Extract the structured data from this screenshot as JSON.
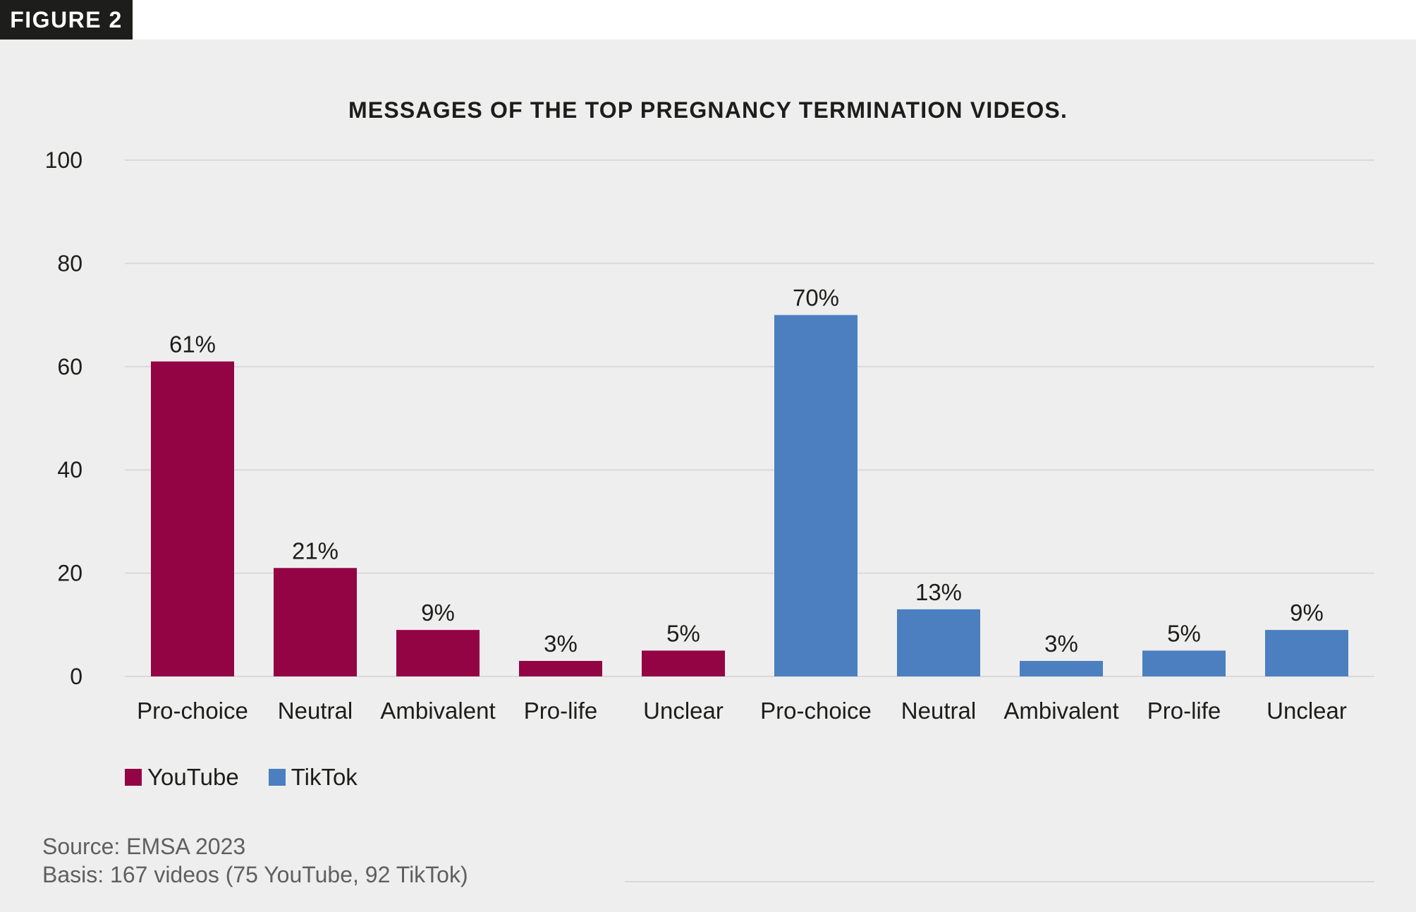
{
  "figure_label": "FIGURE 2",
  "source": {
    "line1": "Source: EMSA 2023",
    "line2": "Basis: 167 videos (75 YouTube, 92 TikTok)"
  },
  "colors": {
    "youtube": "#930444",
    "tiktok": "#4b7fc0",
    "background": "#eeeeee",
    "grid": "#d9d9d9",
    "text": "#1d1d1b"
  },
  "chart_data": {
    "type": "bar",
    "title": "MESSAGES OF THE TOP PREGNANCY TERMINATION VIDEOS.",
    "xlabel": "",
    "ylabel": "",
    "ylim": [
      0,
      100
    ],
    "yticks": [
      0,
      20,
      40,
      60,
      80,
      100
    ],
    "grid": true,
    "legend_position": "bottom-left",
    "value_suffix": "%",
    "groups": [
      {
        "name": "YouTube",
        "color": "#930444",
        "categories": [
          "Pro-choice",
          "Neutral",
          "Ambivalent",
          "Pro-life",
          "Unclear"
        ],
        "values": [
          61,
          21,
          9,
          3,
          5
        ],
        "labels": [
          "61%",
          "21%",
          "9%",
          "3%",
          "5%"
        ]
      },
      {
        "name": "TikTok",
        "color": "#4b7fc0",
        "categories": [
          "Pro-choice",
          "Neutral",
          "Ambivalent",
          "Pro-life",
          "Unclear"
        ],
        "values": [
          70,
          13,
          3,
          5,
          9
        ],
        "labels": [
          "70%",
          "13%",
          "3%",
          "5%",
          "9%"
        ]
      }
    ],
    "legend": [
      {
        "label": "YouTube",
        "color": "#930444"
      },
      {
        "label": "TikTok",
        "color": "#4b7fc0"
      }
    ]
  }
}
